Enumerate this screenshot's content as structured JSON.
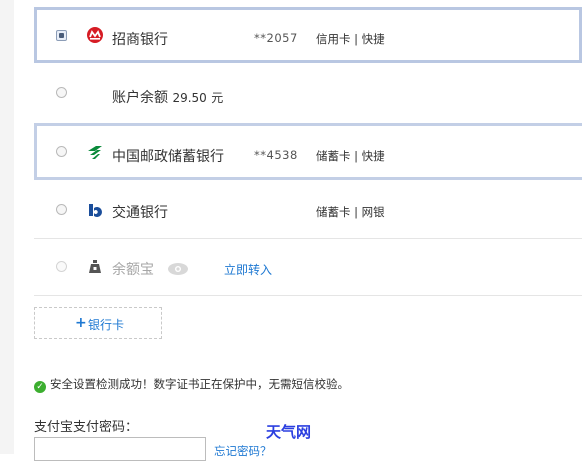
{
  "banks": [
    {
      "name": "招商银行",
      "card": "**2057",
      "type": "信用卡 | 快捷",
      "selected": true
    },
    {
      "name": "账户余额",
      "amount": "29.50",
      "unit": "元"
    },
    {
      "name": "中国邮政储蓄银行",
      "card": "**4538",
      "type": "储蓄卡 | 快捷"
    },
    {
      "name": "交通银行",
      "card": "",
      "type": "储蓄卡 | 网银"
    },
    {
      "name": "余额宝",
      "link": "立即转入"
    }
  ],
  "add_card": {
    "plus": "+",
    "label": "银行卡"
  },
  "notice": {
    "check": "✓",
    "text": "安全设置检测成功！数字证书正在保护中，无需短信校验。"
  },
  "password": {
    "label": "支付宝支付密码：",
    "forgot": "忘记密码？"
  },
  "watermark": "天气网",
  "colors": {
    "accent": "#1e78d2",
    "selected_border": "#b9c7e2",
    "success": "#3cae2f",
    "watermark": "#2b3fe0"
  }
}
